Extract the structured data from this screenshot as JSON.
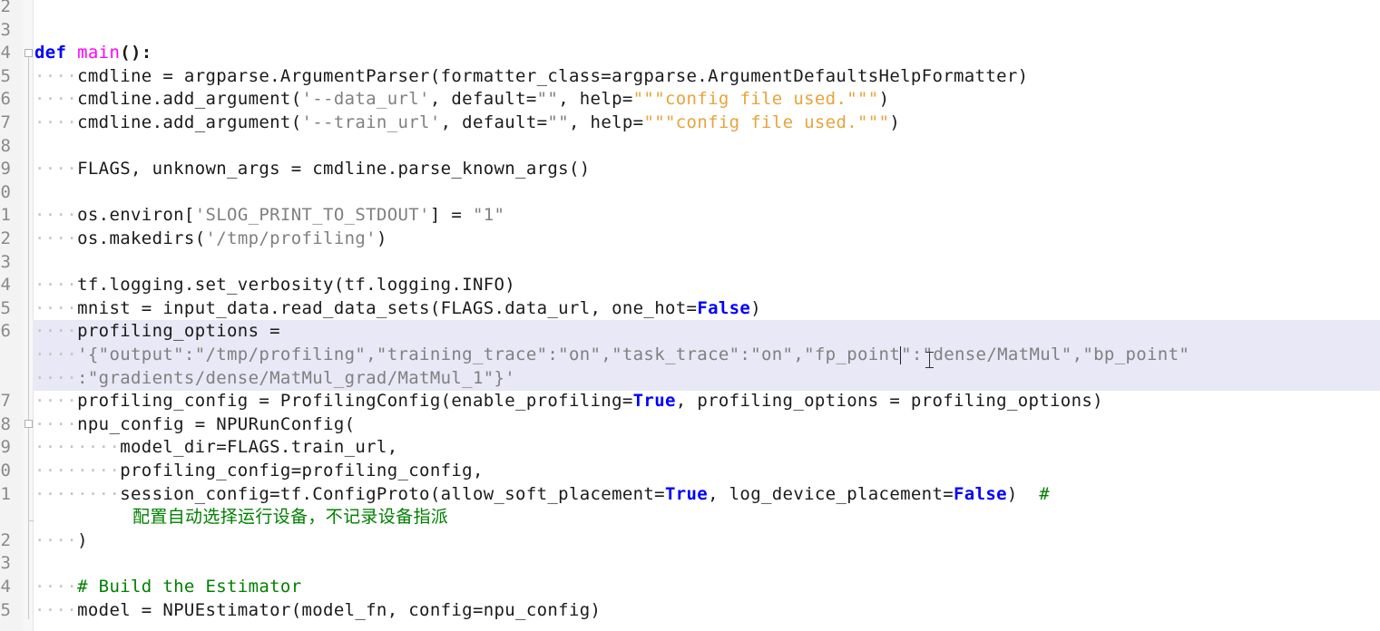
{
  "editor": {
    "line_numbers": [
      "2",
      "3",
      "4",
      "5",
      "6",
      "7",
      "8",
      "9",
      "0",
      "1",
      "2",
      "3",
      "4",
      "5",
      "6",
      "",
      "",
      "7",
      "8",
      "9",
      "0",
      "1",
      "",
      "2",
      "3",
      "4",
      "5"
    ],
    "code": {
      "def_kw": "def",
      "main_fn": "main",
      "main_tail": "():",
      "l5": "cmdline = argparse.ArgumentParser(formatter_class=argparse.ArgumentDefaultsHelpFormatter)",
      "l6_a": "cmdline.add_argument(",
      "l6_s1": "'--data_url'",
      "l6_b": ", default=",
      "l6_s2": "\"\"",
      "l6_c": ", help=",
      "l6_s3": "\"\"\"config file used.\"\"\"",
      "l6_d": ")",
      "l7_a": "cmdline.add_argument(",
      "l7_s1": "'--train_url'",
      "l7_b": ", default=",
      "l7_s2": "\"\"",
      "l7_c": ", help=",
      "l7_s3": "\"\"\"config file used.\"\"\"",
      "l7_d": ")",
      "l9": "FLAGS, unknown_args = cmdline.parse_known_args()",
      "l11_a": "os.environ[",
      "l11_s1": "'SLOG_PRINT_TO_STDOUT'",
      "l11_b": "] = ",
      "l11_s2": "\"1\"",
      "l12_a": "os.makedirs(",
      "l12_s1": "'/tmp/profiling'",
      "l12_b": ")",
      "l14": "tf.logging.set_verbosity(tf.logging.INFO)",
      "l15_a": "mnist = input_data.read_data_sets(FLAGS.data_url, one_hot=",
      "l15_kw": "False",
      "l15_b": ")",
      "l16_a": "profiling_options =",
      "l16_w1_a": "'{\"output\":\"/tmp/profiling\",\"training_trace\":\"on\",\"task_trace\":\"on\",\"fp_point",
      "l16_w1_b": "\":\"dense/MatMul\",\"bp_point\"",
      "l16_w2": ":\"gradients/dense/MatMul_grad/MatMul_1\"}'",
      "l17_a": "profiling_config = ProfilingConfig(enable_profiling=",
      "l17_kw": "True",
      "l17_b": ", profiling_options = profiling_options)",
      "l18": "npu_config = NPURunConfig(",
      "l19": "model_dir=FLAGS.train_url,",
      "l20": "profiling_config=profiling_config,",
      "l21_a": "session_config=tf.ConfigProto(allow_soft_placement=",
      "l21_kw1": "True",
      "l21_b": ", log_device_placement=",
      "l21_kw2": "False",
      "l21_c": ")  ",
      "l21_cm": "#",
      "l21_cm2": "配置自动选择运行设备，不记录设备指派",
      "l22": ")",
      "l24": "# Build the Estimator",
      "l25": "model = NPUEstimator(model_fn, config=npu_config)"
    },
    "indent_4": "····",
    "indent_8": "········"
  },
  "colors": {
    "keyword": "#0000ff",
    "function": "#ff00ff",
    "string": "#808080",
    "docstring": "#e8a33a",
    "comment": "#008000",
    "line_highlight": "#e8e8f6"
  }
}
